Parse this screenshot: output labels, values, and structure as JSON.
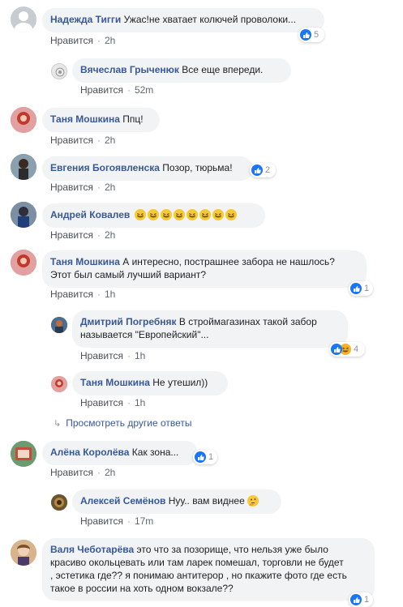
{
  "comments": [
    {
      "author": "Надежда Тигги",
      "text": "Ужас!не хватает колючей проволоки...",
      "like": "Нравится",
      "time": "2h",
      "reactions": "5"
    },
    {
      "author": "Вячеслав Грыченюк",
      "text": "Все еще впереди.",
      "like": "Нравится",
      "time": "52m"
    },
    {
      "author": "Таня Мошкина",
      "text": "Ппц!",
      "like": "Нравится",
      "time": "2h"
    },
    {
      "author": "Евгения Богоявленска",
      "text": "Позор, тюрьма!",
      "like": "Нравится",
      "time": "2h",
      "reactions": "2"
    },
    {
      "author": "Андрей Ковалев",
      "text": "",
      "like": "Нравится",
      "time": "2h"
    },
    {
      "author": "Таня Мошкина",
      "text_line1": "А интересно, пострашнее забора не нашлось?",
      "text_line2": "Этот был самый лучший вариант?",
      "like": "Нравится",
      "time": "1h",
      "reactions": "1"
    },
    {
      "author": "Дмитрий Погребняк",
      "text_line1": "В строймагазинах такой забор",
      "text_line2": "называется \"Европейский\"...",
      "like": "Нравится",
      "time": "1h",
      "reactions": "4"
    },
    {
      "author": "Таня Мошкина",
      "text": "Не утешил))",
      "like": "Нравится",
      "time": "1h"
    },
    {
      "author": "Алёна Королёва",
      "text": "Как зона...",
      "like": "Нравится",
      "time": "2h",
      "reactions": "1"
    },
    {
      "author": "Алексей Семёнов",
      "text": "Нуу.. вам виднее",
      "like": "Нравится",
      "time": "17m"
    },
    {
      "author": "Валя Чеботарёва",
      "text_line1": "это что за позорище, что нельзя уже было",
      "text_line2": "красиво окольцевать или там ларек помешал, торговли не будет",
      "text_line3": ", эстетика где?? я понимаю антитерор , но пкажите фото где есть",
      "text_line4": "такое в россии на хоть одном вокзале??",
      "reactions": "1"
    }
  ],
  "more_replies": "Просмотреть другие ответы",
  "separator": "·",
  "colors": {
    "author": "#385898",
    "bubble": "#f2f3f5",
    "meta": "#606770",
    "like_blue": "#1877f2"
  }
}
